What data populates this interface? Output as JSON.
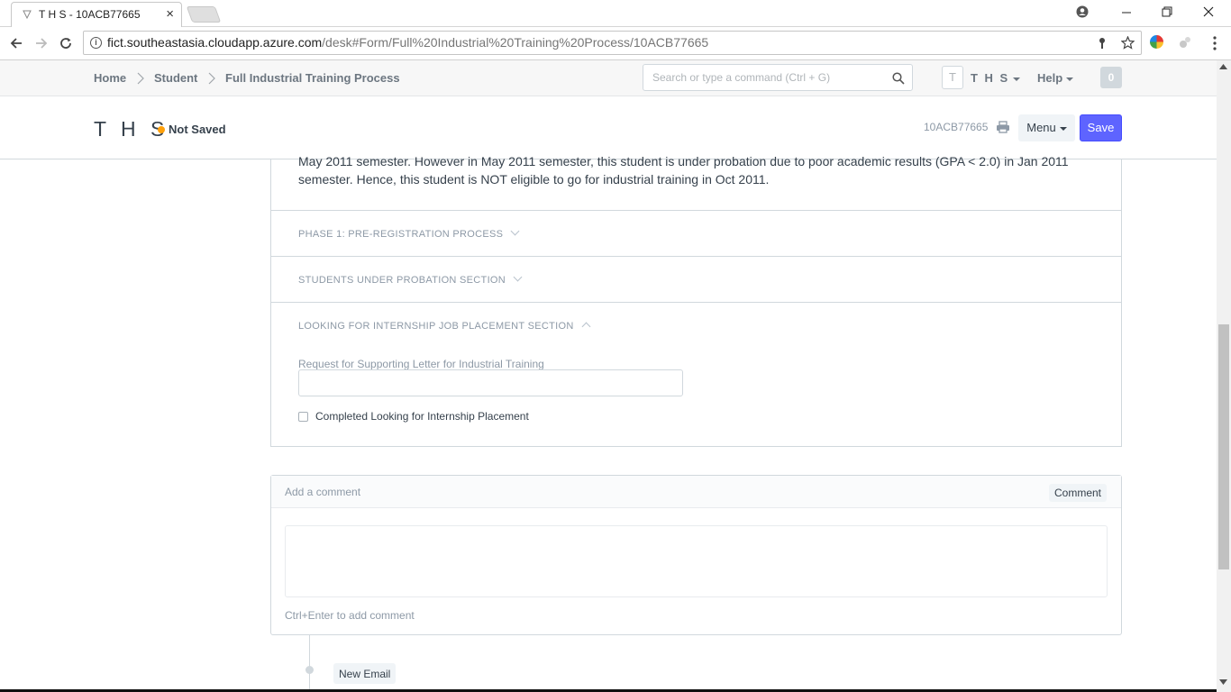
{
  "browser": {
    "tab_title": "T H S - 10ACB77665",
    "tab_close": "×",
    "url_host": "fict.southeastasia.cloudapp.azure.com",
    "url_path": "/desk#Form/Full%20Industrial%20Training%20Process/10ACB77665"
  },
  "navbar": {
    "breadcrumbs": [
      "Home",
      "Student",
      "Full Industrial Training Process"
    ],
    "search_placeholder": "Search or type a command (Ctrl + G)",
    "avatar_letter": "T",
    "user_name": "T H S",
    "help_label": "Help",
    "notification_count": "0"
  },
  "page_head": {
    "title": "T H S",
    "status": "Not Saved",
    "doc_id": "10ACB77665",
    "menu_label": "Menu",
    "save_label": "Save"
  },
  "form": {
    "intro_text": "May 2011 semester. However in May 2011 semester, this student is under probation due to poor academic results (GPA < 2.0) in Jan 2011 semester. Hence, this student is NOT eligible to go for industrial training in Oct 2011.",
    "sections": [
      {
        "label": "PHASE 1: PRE-REGISTRATION PROCESS",
        "expanded": false
      },
      {
        "label": "STUDENTS UNDER PROBATION SECTION",
        "expanded": false
      },
      {
        "label": "LOOKING FOR INTERNSHIP JOB PLACEMENT SECTION",
        "expanded": true
      }
    ],
    "field_label": "Request for Supporting Letter for Industrial Training",
    "field_value": "",
    "checkbox_label": "Completed Looking for Internship Placement",
    "checkbox_checked": false
  },
  "comments": {
    "title": "Add a comment",
    "button_label": "Comment",
    "hint": "Ctrl+Enter to add comment"
  },
  "timeline": {
    "new_email_label": "New Email"
  },
  "colors": {
    "primary": "#5e64ff",
    "indicator_orange": "#ffa00a",
    "muted_text": "#8d99a6"
  }
}
